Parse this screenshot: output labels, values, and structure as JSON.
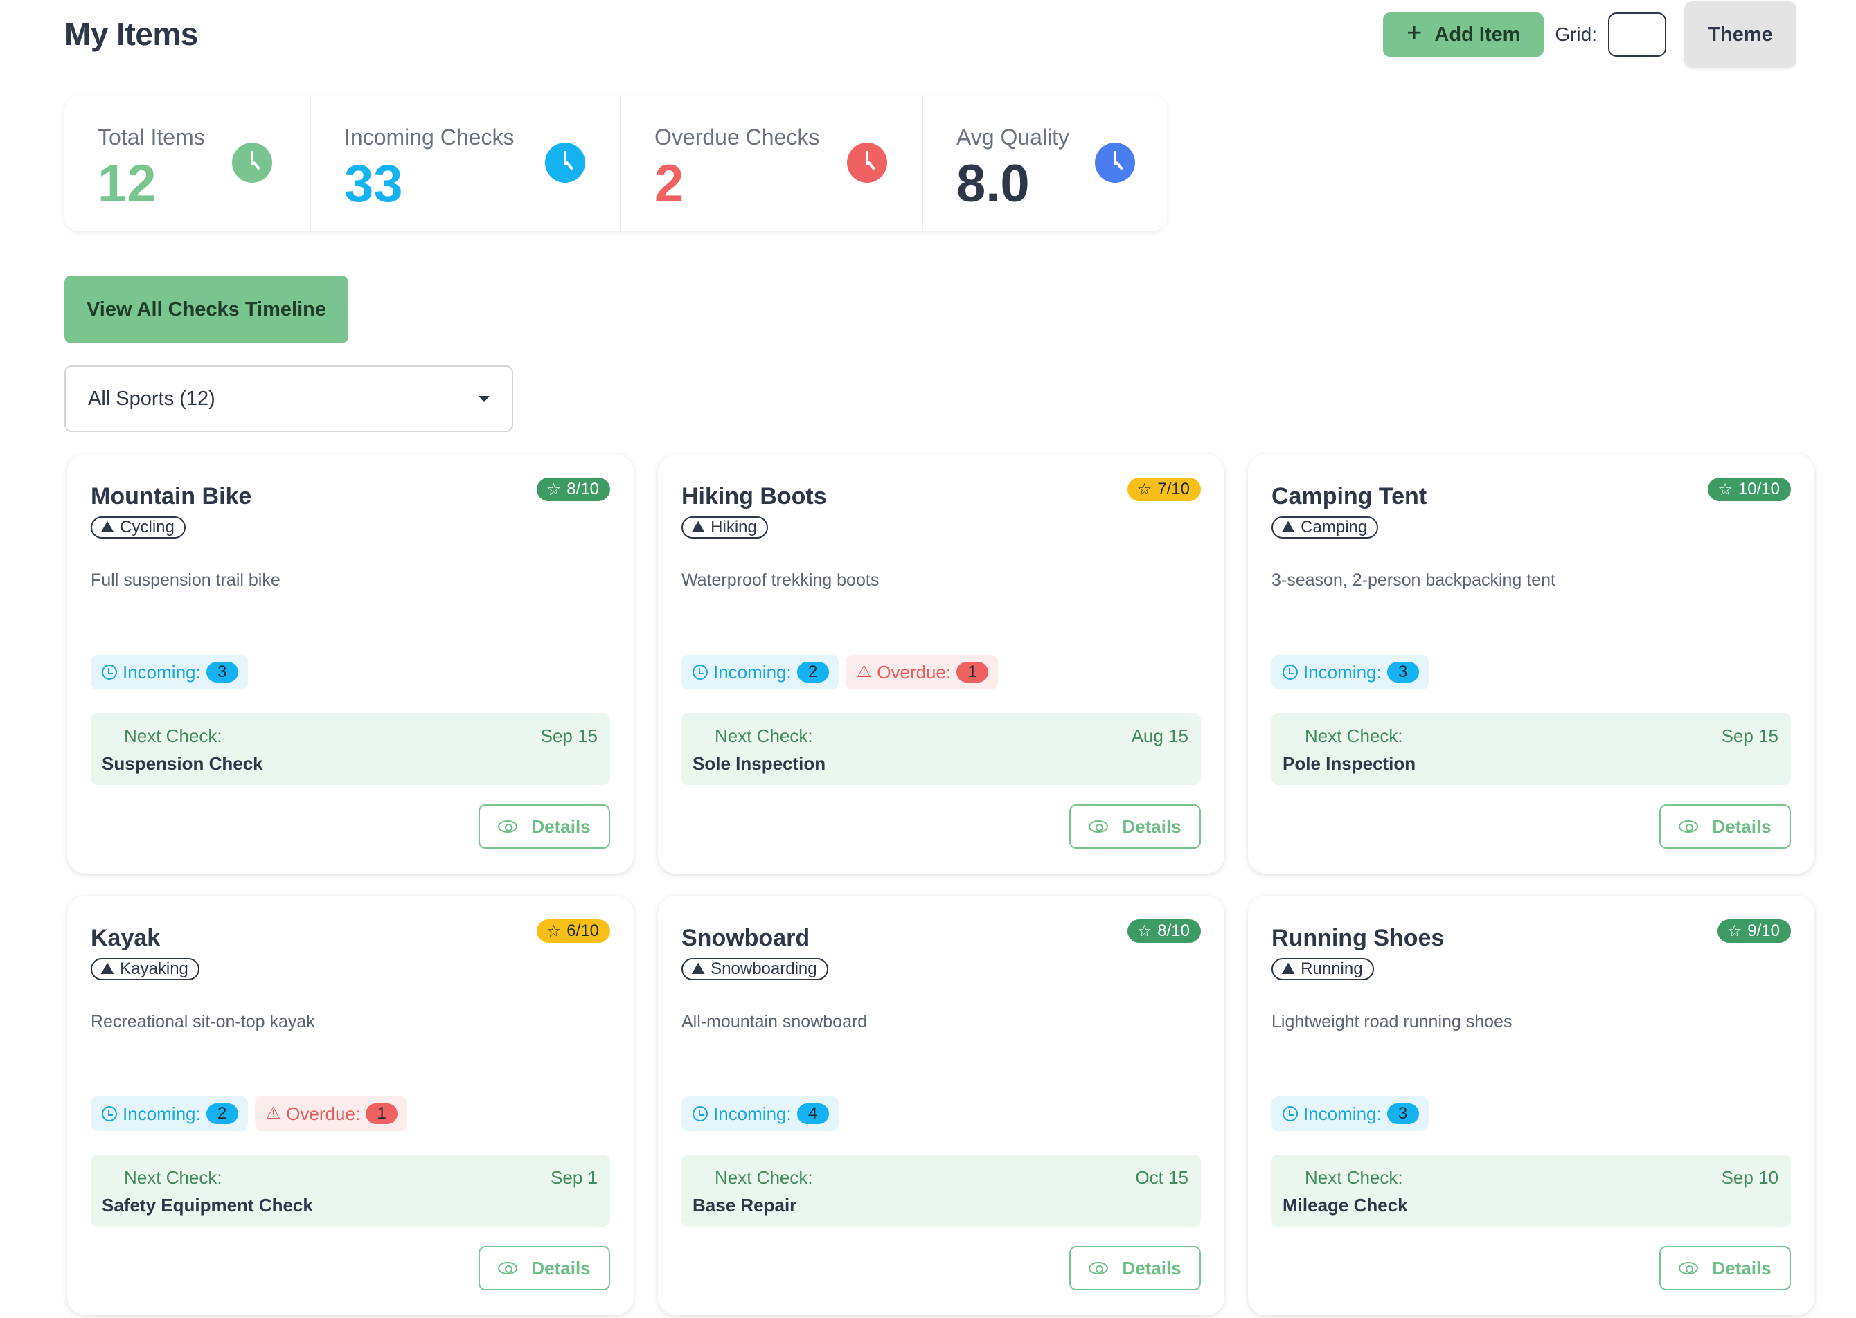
{
  "header": {
    "title": "My Items",
    "add_label": "Add Item",
    "add_icon": "+",
    "grid_label": "Grid:",
    "theme_label": "Theme"
  },
  "stats": [
    {
      "label": "Total Items",
      "value": "12",
      "color": "#7ac48f"
    },
    {
      "label": "Incoming Checks",
      "value": "33",
      "color": "#14b2f0"
    },
    {
      "label": "Overdue Checks",
      "value": "2",
      "color": "#f06161"
    },
    {
      "label": "Avg Quality",
      "value": "8.0",
      "color": "#4a7ef0"
    }
  ],
  "timeline_button": "View All Checks Timeline",
  "filter": {
    "selected": "All Sports (12)"
  },
  "labels": {
    "incoming": "Incoming:",
    "overdue": "Overdue:",
    "next_check": "Next Check:",
    "details": "Details",
    "star": "☆",
    "mountain": "⛰",
    "warning": "⚠"
  },
  "items": [
    {
      "name": "Mountain Bike",
      "rating": "8/10",
      "rating_color": "green",
      "sport": "Cycling",
      "description": "Full suspension trail bike",
      "incoming": "3",
      "overdue": null,
      "next_date": "Sep 15",
      "next_task": "Suspension Check"
    },
    {
      "name": "Hiking Boots",
      "rating": "7/10",
      "rating_color": "yellow",
      "sport": "Hiking",
      "description": "Waterproof trekking boots",
      "incoming": "2",
      "overdue": "1",
      "next_date": "Aug 15",
      "next_task": "Sole Inspection"
    },
    {
      "name": "Camping Tent",
      "rating": "10/10",
      "rating_color": "green",
      "sport": "Camping",
      "description": "3-season, 2-person backpacking tent",
      "incoming": "3",
      "overdue": null,
      "next_date": "Sep 15",
      "next_task": "Pole Inspection"
    },
    {
      "name": "Kayak",
      "rating": "6/10",
      "rating_color": "yellow",
      "sport": "Kayaking",
      "description": "Recreational sit-on-top kayak",
      "incoming": "2",
      "overdue": "1",
      "next_date": "Sep 1",
      "next_task": "Safety Equipment Check"
    },
    {
      "name": "Snowboard",
      "rating": "8/10",
      "rating_color": "green",
      "sport": "Snowboarding",
      "description": "All-mountain snowboard",
      "incoming": "4",
      "overdue": null,
      "next_date": "Oct 15",
      "next_task": "Base Repair"
    },
    {
      "name": "Running Shoes",
      "rating": "9/10",
      "rating_color": "green",
      "sport": "Running",
      "description": "Lightweight road running shoes",
      "incoming": "3",
      "overdue": null,
      "next_date": "Sep 10",
      "next_task": "Mileage Check"
    }
  ]
}
